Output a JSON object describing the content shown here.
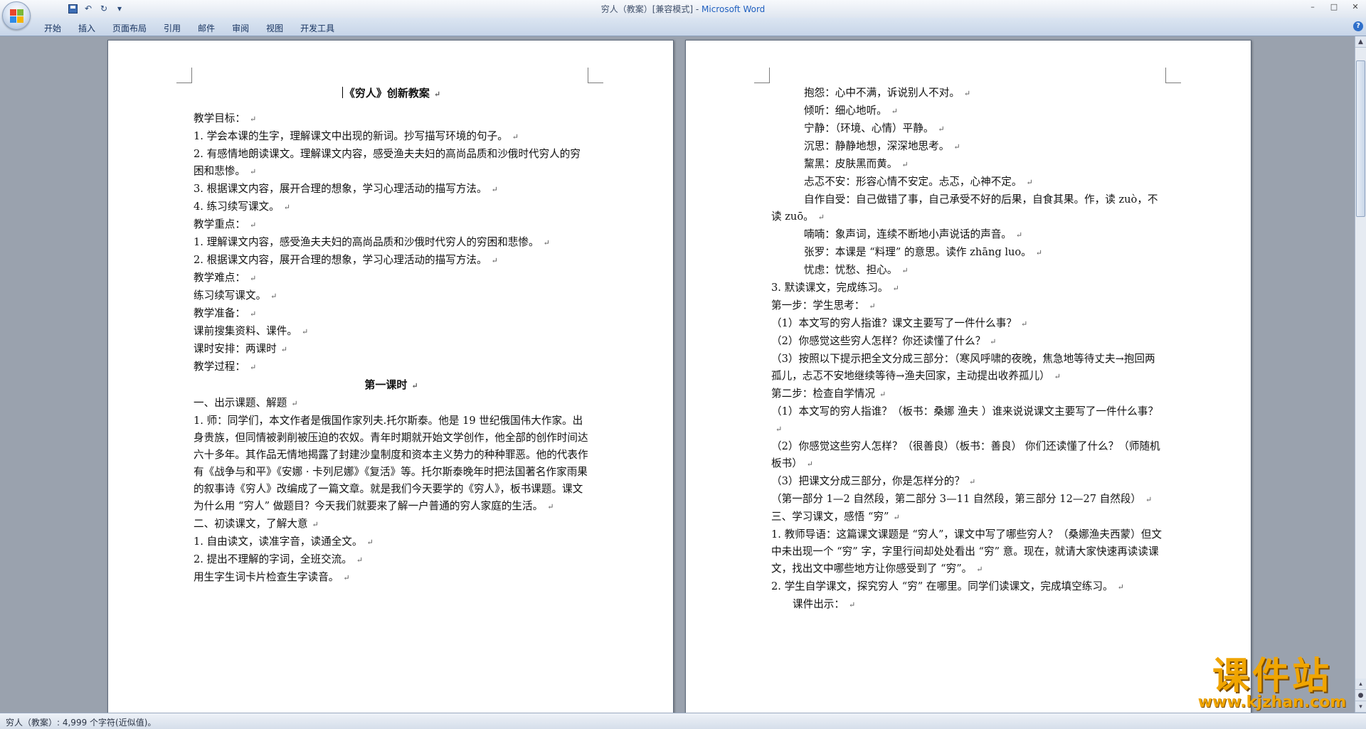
{
  "window": {
    "title": "穷人（教案）[兼容模式] - ",
    "app_name": "Microsoft Word",
    "minimize": "–",
    "maximize": "□",
    "close": "✕"
  },
  "quick_access": {
    "undo": "↶",
    "redo": "↻",
    "customize": "▾"
  },
  "ribbon": {
    "tabs": [
      "开始",
      "插入",
      "页面布局",
      "引用",
      "邮件",
      "审阅",
      "视图",
      "开发工具"
    ],
    "help": "?"
  },
  "left_page": {
    "title": "《穷人》创新教案",
    "paragraphs": [
      "教学目标：",
      "1. 学会本课的生字，理解课文中出现的新词。抄写描写环境的句子。",
      "2. 有感情地朗读课文。理解课文内容，感受渔夫夫妇的高尚品质和沙俄时代穷人的穷困和悲惨。",
      "3. 根据课文内容，展开合理的想象，学习心理活动的描写方法。",
      "4. 练习续写课文。",
      "教学重点：",
      "1. 理解课文内容，感受渔夫夫妇的高尚品质和沙俄时代穷人的穷困和悲惨。",
      "2. 根据课文内容，展开合理的想象，学习心理活动的描写方法。",
      "教学难点：",
      "练习续写课文。",
      "教学准备：",
      "课前搜集资料、课件。",
      "课时安排：两课时",
      "教学过程："
    ],
    "section_heading": "第一课时",
    "paragraphs2": [
      "一、出示课题、解题",
      "1. 师：同学们，本文作者是俄国作家列夫.托尔斯泰。他是 19 世纪俄国伟大作家。出身贵族，但同情被剥削被压迫的农奴。青年时期就开始文学创作，他全部的创作时间达六十多年。其作品无情地揭露了封建沙皇制度和资本主义势力的种种罪恶。他的代表作有《战争与和平》《安娜 · 卡列尼娜》《复活》等。托尔斯泰晚年时把法国著名作家雨果的叙事诗《穷人》改编成了一篇文章。就是我们今天要学的《穷人》，板书课题。课文为什么用 “穷人” 做题目？今天我们就要来了解一户普通的穷人家庭的生活。",
      "二、初读课文，了解大意",
      "1. 自由读文，读准字音，读通全文。",
      "2. 提出不理解的字词，全班交流。",
      "用生字生词卡片检查生字读音。"
    ]
  },
  "right_page": {
    "vocab": [
      "抱怨：心中不满，诉说别人不对。",
      "倾听：细心地听。",
      "宁静：（环境、心情）平静。",
      "沉思：静静地想，深深地思考。",
      "黧黑：皮肤黑而黄。",
      "忐忑不安：形容心情不安定。忐忑，心神不定。",
      "自作自受：自己做错了事，自己承受不好的后果，自食其果。作，读 zuò，不读 zuō。",
      "喃喃：象声词，连续不断地小声说话的声音。",
      "张罗：本课是 “料理” 的意思。读作 zhāng luo。",
      "忧虑：忧愁、担心。"
    ],
    "paragraphs": [
      "3. 默读课文，完成练习。",
      "第一步：学生思考：",
      "（1）本文写的穷人指谁？课文主要写了一件什么事？",
      "（2）你感觉这些穷人怎样？你还读懂了什么？",
      "（3）按照以下提示把全文分成三部分：（寒风呼啸的夜晚，焦急地等待丈夫→抱回两孤儿，忐忑不安地继续等待→渔夫回家，主动提出收养孤儿）",
      "第二步：检查自学情况",
      "（1）本文写的穷人指谁？（板书：桑娜 渔夫 ）谁来说说课文主要写了一件什么事？",
      "（2）你感觉这些穷人怎样？（很善良）（板书：善良） 你们还读懂了什么？（师随机板书）",
      "（3）把课文分成三部分，你是怎样分的？",
      "（第一部分 1—2 自然段，第二部分 3—11 自然段，第三部分 12—27 自然段）",
      "三、学习课文，感悟 “穷”",
      "1. 教师导语：这篇课文课题是 “穷人”，课文中写了哪些穷人？（桑娜渔夫西蒙）但文中未出现一个 “穷” 字，字里行间却处处看出 “穷” 意。现在，就请大家快速再读读课文，找出文中哪些地方让你感受到了 “穷”。",
      "2. 学生自学课文，探究穷人 “穷” 在哪里。同学们读课文，完成填空练习。"
    ],
    "last_line": "课件出示："
  },
  "status_bar": {
    "text": "穷人（教案）: 4,999 个字符(近似值)。"
  },
  "watermark": {
    "cn": "课件站",
    "url": "www.kjzhan.com"
  },
  "icons": [
    "office-button-icon",
    "save-icon",
    "undo-icon",
    "redo-icon",
    "help-icon",
    "paragraph-mark-icon"
  ]
}
